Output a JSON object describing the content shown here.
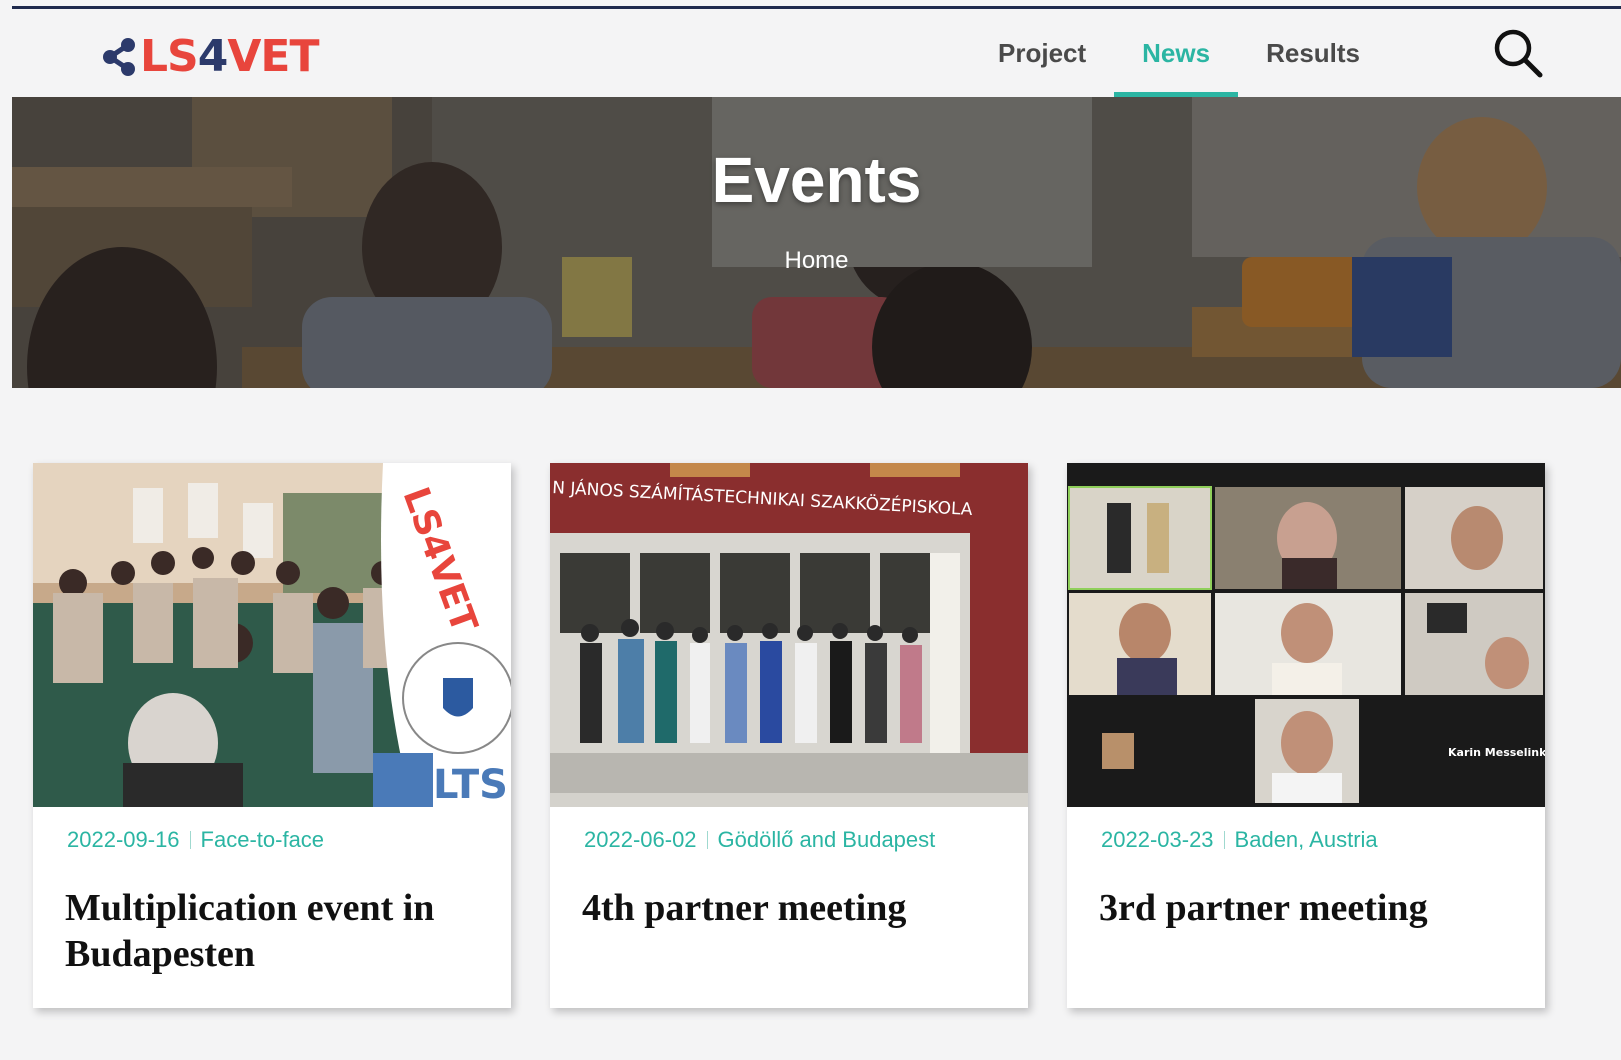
{
  "brand": {
    "logo_parts": [
      "LS",
      "4",
      "VET"
    ],
    "colors": {
      "red": "#e8453c",
      "navy": "#2c3a6b",
      "teal": "#2bb5a3"
    }
  },
  "nav": {
    "items": [
      {
        "label": "Project",
        "active": false
      },
      {
        "label": "News",
        "active": true
      },
      {
        "label": "Results",
        "active": false
      }
    ],
    "search_icon": "search-icon"
  },
  "hero": {
    "title": "Events",
    "breadcrumb": "Home"
  },
  "cards": [
    {
      "date": "2022-09-16",
      "location": "Face-to-face",
      "title": "Multiplication event in Budapesten",
      "image_sign_text": [
        "LS4VET",
        "LTS"
      ]
    },
    {
      "date": "2022-06-02",
      "location": "Gödöllő and Budapest",
      "title": "4th partner meeting",
      "image_sign_text": "N JÁNOS SZÁMÍTÁSTECHNIKAI SZAKKÖZÉPISKOLA"
    },
    {
      "date": "2022-03-23",
      "location": "Baden, Austria",
      "title": "3rd partner meeting",
      "image_sign_text": "Karin Messelink"
    }
  ]
}
